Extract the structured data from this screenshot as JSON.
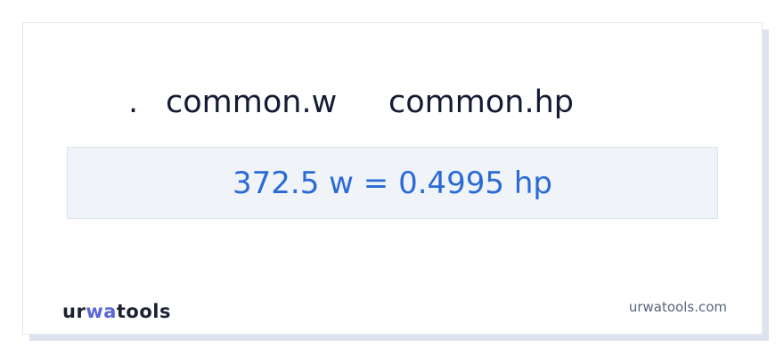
{
  "header": {
    "dot": ".",
    "from_unit": "common.w",
    "to_unit": "common.hp"
  },
  "result": {
    "text": "372.5 w = 0.4995 hp"
  },
  "footer": {
    "logo_text": "urwatools",
    "logo_part1": "ur",
    "logo_part2": "wa",
    "logo_part3": "tools",
    "site_url": "urwatools.com"
  },
  "colors": {
    "result_text": "#2a6ad6",
    "logo_accent": "#5a66d9",
    "heading_text": "#141c33"
  }
}
